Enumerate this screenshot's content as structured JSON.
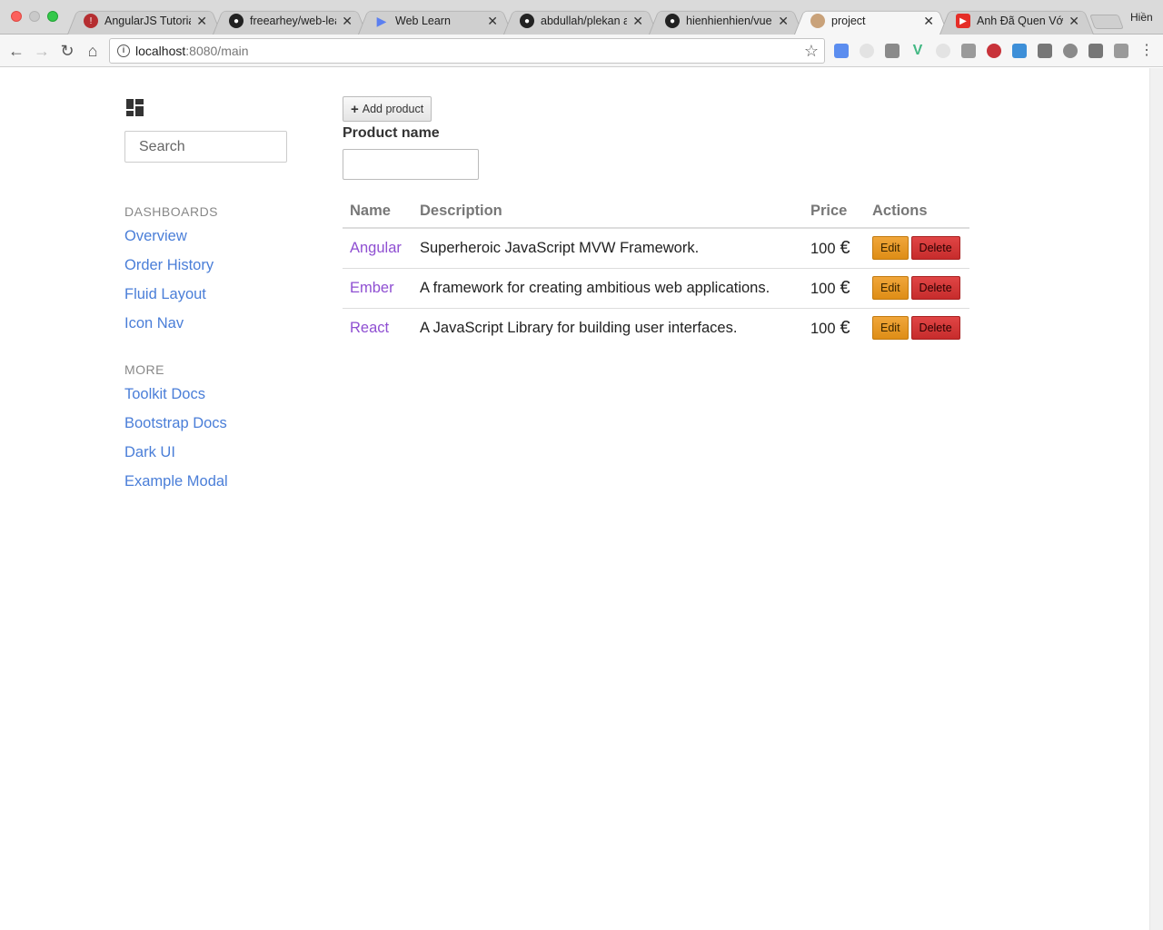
{
  "browser": {
    "tabs": [
      {
        "title": "AngularJS Tutorial",
        "favicon": "angular-icon",
        "color": "#b52e31"
      },
      {
        "title": "freearhey/web-lea",
        "favicon": "github-icon",
        "color": "#222222"
      },
      {
        "title": "Web Learn",
        "favicon": "play-icon",
        "color": "#5b7ff0"
      },
      {
        "title": "abdullah/plekan at",
        "favicon": "github-icon",
        "color": "#222222"
      },
      {
        "title": "hienhienhien/vue-c",
        "favicon": "github-icon",
        "color": "#222222"
      },
      {
        "title": "project",
        "favicon": "avatar-icon",
        "color": "#c9a27a",
        "active": true
      },
      {
        "title": "Anh Đã Quen Với C",
        "favicon": "youtube-icon",
        "color": "#e52d27"
      }
    ],
    "profile_name": "Hiền",
    "url_host": "localhost",
    "url_rest": ":8080/main"
  },
  "sidebar": {
    "search_placeholder": "Search",
    "sections": [
      {
        "header": "DASHBOARDS",
        "links": [
          "Overview",
          "Order History",
          "Fluid Layout",
          "Icon Nav"
        ]
      },
      {
        "header": "MORE",
        "links": [
          "Toolkit Docs",
          "Bootstrap Docs",
          "Dark UI",
          "Example Modal"
        ]
      }
    ]
  },
  "main": {
    "add_button_label": "Add product",
    "field_label": "Product name",
    "field_value": "",
    "table": {
      "headers": [
        "Name",
        "Description",
        "Price",
        "Actions"
      ],
      "rows": [
        {
          "name": "Angular",
          "description": "Superheroic JavaScript MVW Framework.",
          "price": "100",
          "currency": "€"
        },
        {
          "name": "Ember",
          "description": "A framework for creating ambitious web applications.",
          "price": "100",
          "currency": "€"
        },
        {
          "name": "React",
          "description": "A JavaScript Library for building user interfaces.",
          "price": "100",
          "currency": "€"
        }
      ],
      "edit_label": "Edit",
      "delete_label": "Delete"
    }
  }
}
